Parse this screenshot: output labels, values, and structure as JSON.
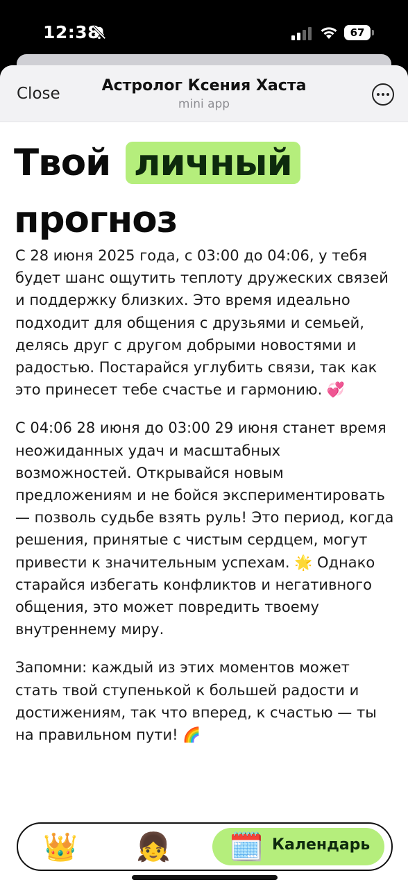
{
  "status_bar": {
    "time": "12:38",
    "battery": "67",
    "icons": [
      "bell-slash-icon",
      "signal-icon",
      "wifi-icon",
      "battery-icon"
    ]
  },
  "header": {
    "close_label": "Close",
    "title": "Астролог Ксения Хаста",
    "subtitle": "mini app",
    "more_icon": "more-icon"
  },
  "headline": {
    "part1": "Твой",
    "highlight": "личный",
    "part2": "прогноз"
  },
  "paragraphs": [
    "С 28 июня 2025 года, с 03:00 до 04:06, у тебя будет шанс ощутить теплоту дружеских связей и поддержку близких. Это время идеально подходит для общения с друзьями и семьей, делясь друг с другом добрыми новостями и радостью. Постарайся углубить связи, так как это принесет тебе счастье и гармонию. 💞",
    "С 04:06 28 июня до 03:00 29 июня станет время неожиданных удач и масштабных возможностей. Открывайся новым предложениям и не бойся экспериментировать — позволь судьбе взять руль! Это период, когда решения, принятые с чистым сердцем, могут привести к значительным успехам. 🌟 Однако старайся избегать конфликтов и негативного общения, это может повредить твоему внутреннему миру.",
    "Запомни: каждый из этих моментов может стать твой ступенькой к большей радости и достижениям, так что вперед, к счастью — ты на правильном пути! 🌈"
  ],
  "nav": {
    "crown_icon": "👑",
    "person_icon": "👧",
    "calendar_icon": "🗓️",
    "calendar_label": "Календарь"
  },
  "colors": {
    "accent_green": "#b5ee7c",
    "header_bg": "#f2f2f4"
  }
}
